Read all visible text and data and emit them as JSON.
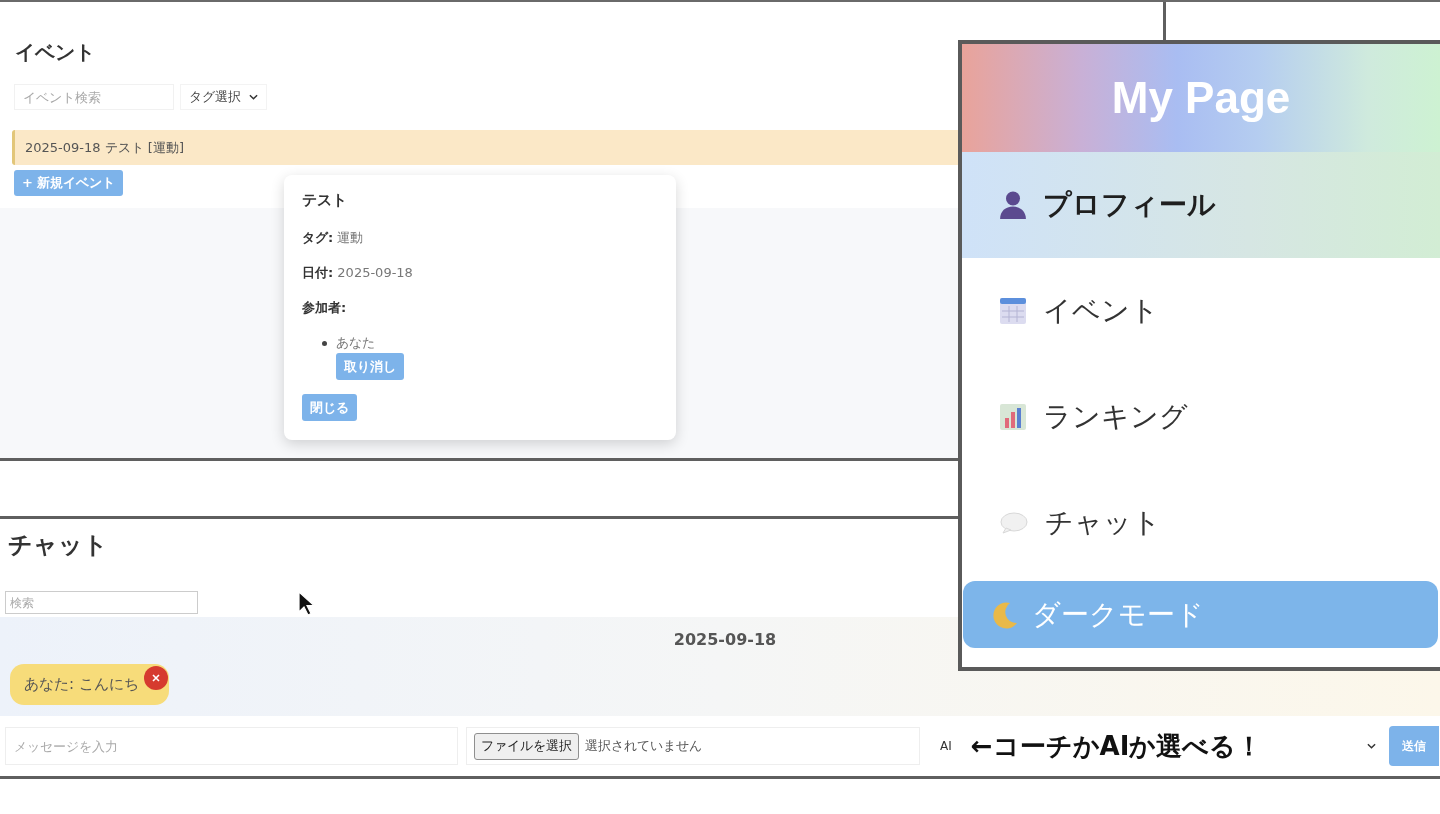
{
  "event_panel": {
    "title": "イベント",
    "search": {
      "placeholder": "イベント検索"
    },
    "tag_select": {
      "value": "タグ選択"
    },
    "events": [
      {
        "text": "2025-09-18 テスト [運動]"
      }
    ],
    "new_event_button": "+ 新規イベント"
  },
  "event_popup": {
    "title": "テスト",
    "details": [
      "**タグ:** 運動",
      "**日付:** 2025-09-18"
    ],
    "participants_label": "参加者:",
    "participants": [
      {
        "name": "あなた",
        "cancel_button": "取り消し"
      }
    ],
    "close_button": "閉じる"
  },
  "menu": {
    "title": "My Page",
    "items": [
      {
        "label": "プロフィール",
        "selected": true
      },
      {
        "label": "イベント",
        "selected": false
      },
      {
        "label": "ランキング",
        "selected": false
      },
      {
        "label": "チャット",
        "selected": false
      }
    ],
    "dark_mode_button": "ダークモード"
  },
  "chat_panel": {
    "title": "チャット",
    "search": {
      "placeholder": "検索"
    },
    "date": "2025-09-18",
    "messages": [
      {
        "text": "あなた: こんにち"
      }
    ],
    "composer": {
      "message": {
        "placeholder": "メッセージを入力"
      },
      "file_button": "ファイルを選択",
      "file_status": "選択されていません",
      "mode_select": {
        "value": "AI"
      },
      "send_button": "送信"
    }
  },
  "annotation": "←コーチかAIか選べる！"
}
